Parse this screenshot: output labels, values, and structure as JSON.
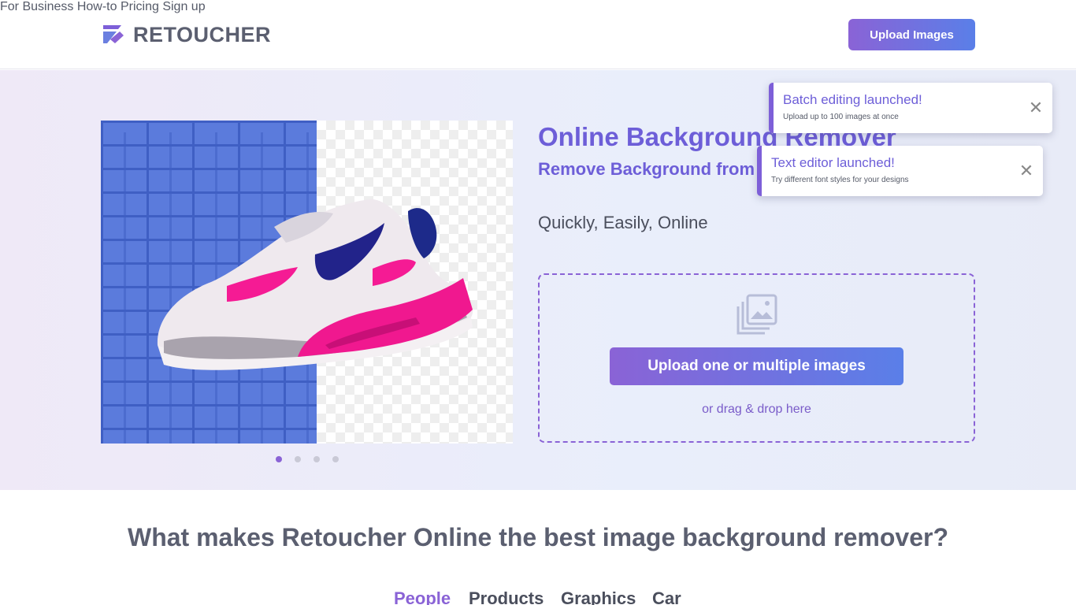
{
  "header": {
    "brand": "RETOUCHER",
    "nav": [
      "For Business",
      "How-to",
      "Pricing",
      "Sign up"
    ],
    "upload_button": "Upload Images"
  },
  "hero": {
    "title": "Online Background Remover",
    "subtitle": "Remove Background from",
    "tagline": "Quickly, Easily, Online",
    "upload_button": "Upload one or multiple images",
    "drag_text": "or drag & drop here",
    "slides_total": 4,
    "slide_active": 1
  },
  "toasts": [
    {
      "title": "Batch editing launched!",
      "text": "Upload up to 100 images at once"
    },
    {
      "title": "Text editor launched!",
      "text": "Try different font styles for your designs"
    }
  ],
  "features": {
    "title": "What makes Retoucher Online the best image background remover?",
    "tabs": [
      "People",
      "Products",
      "Graphics",
      "Car"
    ],
    "active_tab": "People"
  },
  "colors": {
    "accent": "#8a63d6",
    "accent_blue": "#5a7fe8",
    "title_purple": "#6d5ed8"
  },
  "icons": [
    "retoucher-logo-icon",
    "images-stack-icon",
    "close-icon"
  ]
}
